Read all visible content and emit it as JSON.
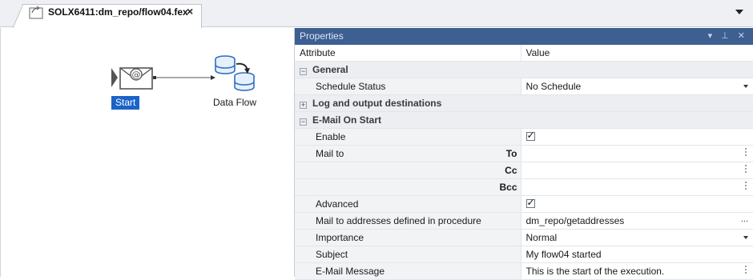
{
  "tab": {
    "title": "SOLX6411:dm_repo/flow04.fex",
    "close": "×"
  },
  "canvas": {
    "nodes": [
      {
        "label": "Start",
        "icon": "email-trigger-icon",
        "selected": true
      },
      {
        "label": "Data Flow",
        "icon": "database-flow-icon",
        "selected": false
      }
    ]
  },
  "properties": {
    "title": "Properties",
    "controls": "▾ ⊥ ✕",
    "columns": {
      "attribute": "Attribute",
      "value": "Value"
    },
    "categories": {
      "general": {
        "label": "General",
        "toggle": "−"
      },
      "log": {
        "label": "Log and output destinations",
        "toggle": "+"
      },
      "email": {
        "label": "E-Mail On Start",
        "toggle": "−"
      }
    },
    "rows": {
      "schedule_status": {
        "label": "Schedule Status",
        "value": "No Schedule"
      },
      "enable": {
        "label": "Enable",
        "checked": true
      },
      "mail_to": {
        "label": "Mail to",
        "to": "To",
        "cc": "Cc",
        "bcc": "Bcc"
      },
      "advanced": {
        "label": "Advanced",
        "checked": true
      },
      "mail_addresses": {
        "label": "Mail to addresses defined in procedure",
        "value": "dm_repo/getaddresses",
        "button": "..."
      },
      "importance": {
        "label": "Importance",
        "value": "Normal"
      },
      "subject": {
        "label": "Subject",
        "value": "My flow04 started"
      },
      "message": {
        "label": "E-Mail Message",
        "value": "This is the start of the execution."
      }
    }
  },
  "colors": {
    "panel_header": "#3d5f92",
    "selection": "#1a63c7",
    "category_bg": "#eceef1"
  }
}
